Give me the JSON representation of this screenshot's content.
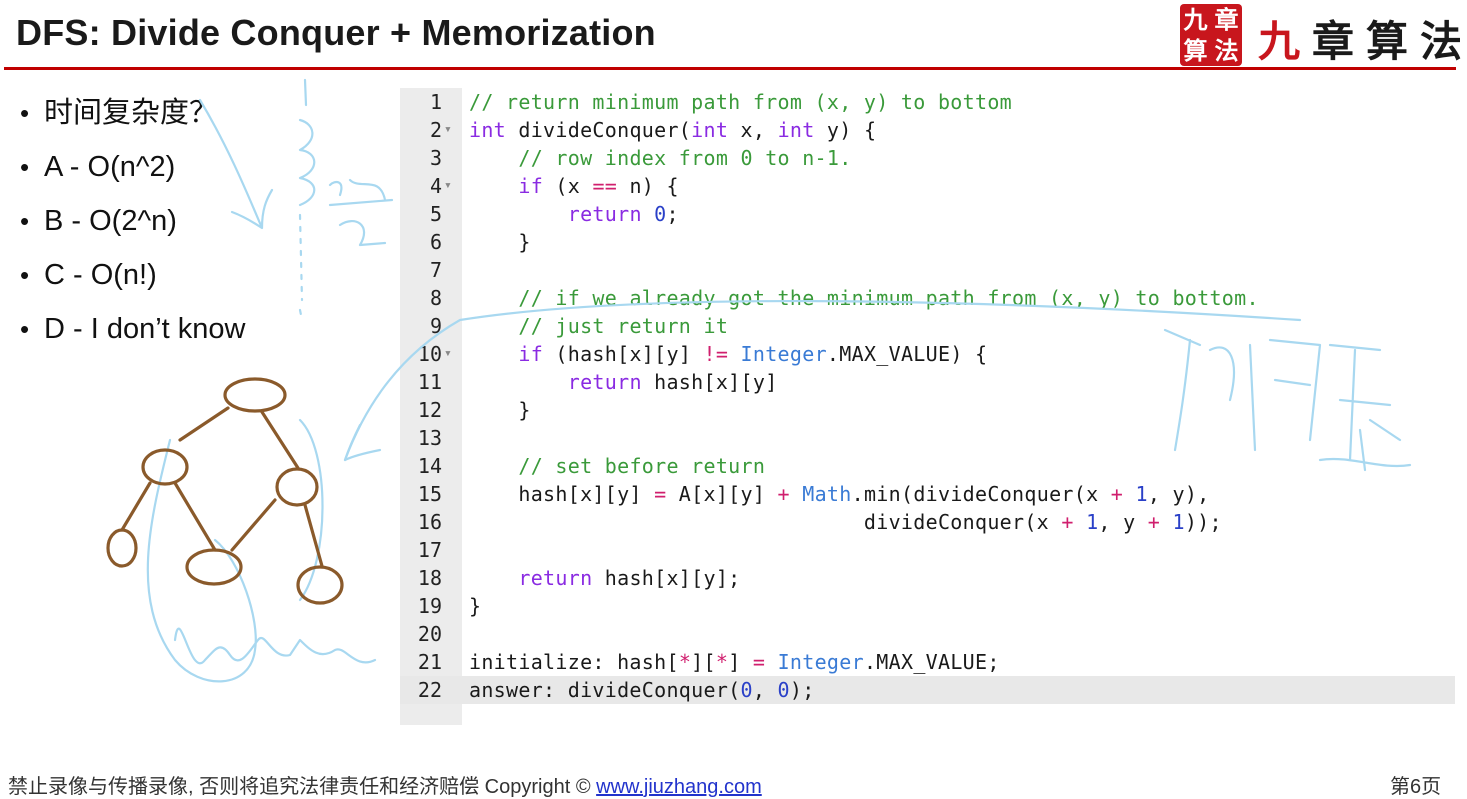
{
  "header": {
    "title": "DFS: Divide Conquer + Memorization",
    "logo_seal_chars": [
      "九",
      "章",
      "算",
      "法"
    ],
    "logo_text_first": "九",
    "logo_text_rest": "章算法",
    "accent_color": "#c00000"
  },
  "bullets": [
    "时间复杂度？",
    "A - O(n^2)",
    "B - O(2^n)",
    "C - O(n!)",
    "D - I don’t know"
  ],
  "code": {
    "active_line": 22,
    "lines": [
      {
        "n": "1",
        "fold": false
      },
      {
        "n": "2",
        "fold": true
      },
      {
        "n": "3",
        "fold": false
      },
      {
        "n": "4",
        "fold": true
      },
      {
        "n": "5",
        "fold": false
      },
      {
        "n": "6",
        "fold": false
      },
      {
        "n": "7",
        "fold": false
      },
      {
        "n": "8",
        "fold": false
      },
      {
        "n": "9",
        "fold": false
      },
      {
        "n": "10",
        "fold": true
      },
      {
        "n": "11",
        "fold": false
      },
      {
        "n": "12",
        "fold": false
      },
      {
        "n": "13",
        "fold": false
      },
      {
        "n": "14",
        "fold": false
      },
      {
        "n": "15",
        "fold": false
      },
      {
        "n": "16",
        "fold": false
      },
      {
        "n": "17",
        "fold": false
      },
      {
        "n": "18",
        "fold": false
      },
      {
        "n": "19",
        "fold": false
      },
      {
        "n": "20",
        "fold": false
      },
      {
        "n": "21",
        "fold": false
      },
      {
        "n": "22",
        "fold": false
      }
    ],
    "tokens": [
      [
        [
          "c",
          "// return minimum path from (x, y) to bottom"
        ]
      ],
      [
        [
          "k",
          "int"
        ],
        [
          "",
          " divideConquer("
        ],
        [
          "k",
          "int"
        ],
        [
          "",
          " x, "
        ],
        [
          "k",
          "int"
        ],
        [
          "",
          " y) {"
        ]
      ],
      [
        [
          "",
          "    "
        ],
        [
          "c",
          "// row index from 0 to n-1."
        ]
      ],
      [
        [
          "",
          "    "
        ],
        [
          "k",
          "if"
        ],
        [
          "",
          " (x "
        ],
        [
          "o",
          "=="
        ],
        [
          "",
          " n) {"
        ]
      ],
      [
        [
          "",
          "        "
        ],
        [
          "k",
          "return"
        ],
        [
          "",
          " "
        ],
        [
          "n",
          "0"
        ],
        [
          "",
          ";"
        ]
      ],
      [
        [
          "",
          "    }"
        ]
      ],
      [],
      [
        [
          "",
          "    "
        ],
        [
          "c",
          "// if we already got the minimum path from (x, y) to bottom."
        ]
      ],
      [
        [
          "",
          "    "
        ],
        [
          "c",
          "// just return it"
        ]
      ],
      [
        [
          "",
          "    "
        ],
        [
          "k",
          "if"
        ],
        [
          "",
          " (hash[x][y] "
        ],
        [
          "o",
          "!="
        ],
        [
          "",
          " "
        ],
        [
          "ty",
          "Integer"
        ],
        [
          "",
          ".MAX_VALUE) {"
        ]
      ],
      [
        [
          "",
          "        "
        ],
        [
          "k",
          "return"
        ],
        [
          "",
          " hash[x][y]"
        ]
      ],
      [
        [
          "",
          "    }"
        ]
      ],
      [],
      [
        [
          "",
          "    "
        ],
        [
          "c",
          "// set before return"
        ]
      ],
      [
        [
          "",
          "    hash[x][y] "
        ],
        [
          "o",
          "="
        ],
        [
          "",
          " A[x][y] "
        ],
        [
          "o",
          "+"
        ],
        [
          "",
          " "
        ],
        [
          "ty",
          "Math"
        ],
        [
          "",
          ".min(divideConquer(x "
        ],
        [
          "o",
          "+"
        ],
        [
          "",
          " "
        ],
        [
          "n",
          "1"
        ],
        [
          "",
          ", y),"
        ]
      ],
      [
        [
          "",
          "                                divideConquer(x "
        ],
        [
          "o",
          "+"
        ],
        [
          "",
          " "
        ],
        [
          "n",
          "1"
        ],
        [
          "",
          ", y "
        ],
        [
          "o",
          "+"
        ],
        [
          "",
          " "
        ],
        [
          "n",
          "1"
        ],
        [
          "",
          "));"
        ]
      ],
      [],
      [
        [
          "",
          "    "
        ],
        [
          "k",
          "return"
        ],
        [
          "",
          " hash[x][y];"
        ]
      ],
      [
        [
          "",
          "}"
        ]
      ],
      [],
      [
        [
          "",
          "initialize: hash["
        ],
        [
          "o",
          "*"
        ],
        [
          "",
          "]["
        ],
        [
          "o",
          "*"
        ],
        [
          "",
          "] "
        ],
        [
          "o",
          "="
        ],
        [
          "",
          " "
        ],
        [
          "ty",
          "Integer"
        ],
        [
          "",
          ".MAX_VALUE;"
        ]
      ],
      [
        [
          "",
          "answer: divideConquer("
        ],
        [
          "n",
          "0"
        ],
        [
          "",
          ", "
        ],
        [
          "n",
          "0"
        ],
        [
          "",
          ");"
        ]
      ]
    ]
  },
  "footer": {
    "notice": "禁止录像与传播录像, 否则将追究法律责任和经济赔偿 Copyright © ",
    "link": "www.jiuzhang.com",
    "page": "第6页"
  },
  "colors": {
    "comment": "#3a9a3a",
    "keyword": "#8a2be2",
    "number": "#2a40c8",
    "operator": "#d01f6e",
    "type": "#3a7bd5",
    "tree_ink": "#8a5a2b",
    "blue_ink": "#a8d8f0"
  }
}
